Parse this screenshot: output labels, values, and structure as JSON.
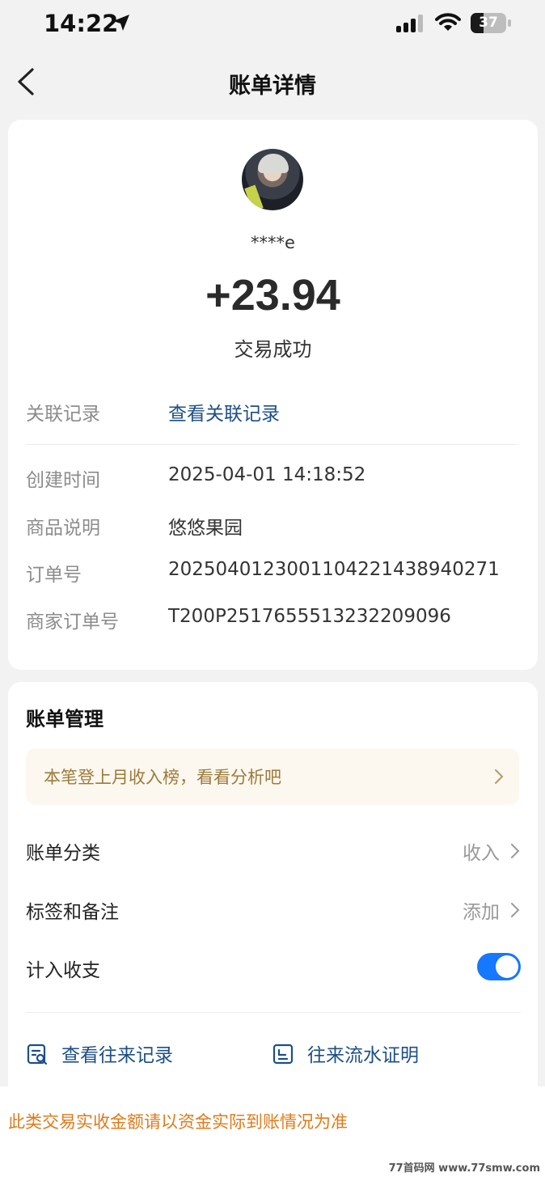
{
  "status_bar": {
    "time": "14:22",
    "battery": "37",
    "battery_level": 0.37,
    "icons": [
      "location-arrow-icon",
      "signal-icon",
      "wifi-icon",
      "battery-icon"
    ]
  },
  "nav": {
    "title": "账单详情",
    "back_icon": "chevron-left-icon"
  },
  "transaction": {
    "payer": "****e",
    "amount": "+23.94",
    "status": "交易成功"
  },
  "related": {
    "label": "关联记录",
    "link": "查看关联记录"
  },
  "details": [
    {
      "label": "创建时间",
      "value": "2025-04-01 14:18:52"
    },
    {
      "label": "商品说明",
      "value": "悠悠果园"
    },
    {
      "label": "订单号",
      "value": "2025040123001104221438940271"
    },
    {
      "label": "商家订单号",
      "value": "T200P2517655513232209096"
    }
  ],
  "management": {
    "title": "账单管理",
    "tip": "本笔登上月收入榜，看看分析吧",
    "category_label": "账单分类",
    "category_value": "收入",
    "tags_label": "标签和备注",
    "tags_value": "添加",
    "include_label": "计入收支",
    "include_on": true
  },
  "actions": {
    "records": "查看往来记录",
    "proof": "往来流水证明"
  },
  "notice": "此类交易实收金额请以资金实际到账情况为准",
  "watermark": "77首码网 www.77smw.com",
  "colors": {
    "link": "#1d4f86",
    "toggle": "#1677ff",
    "notice": "#e07a1a",
    "tip_text": "#9c7a3a",
    "tip_bg": "#fdf8ef"
  }
}
